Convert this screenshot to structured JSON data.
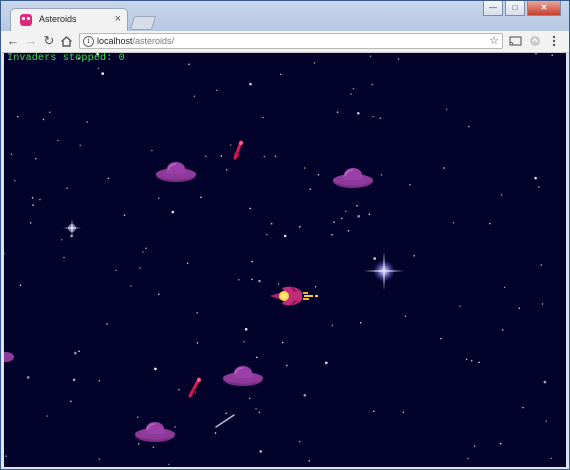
{
  "browser": {
    "tab_title": "Asteroids",
    "tab_close": "×",
    "window_controls": {
      "minimize": "—",
      "maximize": "□",
      "close": "✕"
    },
    "url_host": "localhost",
    "url_path": "/asteroids/",
    "icons": [
      "back-icon",
      "forward-icon",
      "reload-icon",
      "home-icon",
      "info-icon",
      "star-icon",
      "cast-icon",
      "extension-icon",
      "menu-icon"
    ]
  },
  "game": {
    "score_label": "Invaders stopped:",
    "score_value": "0",
    "background_color": "#03022a",
    "score_color": "#3ee24a",
    "invader_color": "#8a2f93",
    "ship_color": "#b0206a",
    "missile_color": "#e01858",
    "sprites": [
      "player-ship",
      "invader-ufo",
      "missile",
      "star"
    ]
  }
}
